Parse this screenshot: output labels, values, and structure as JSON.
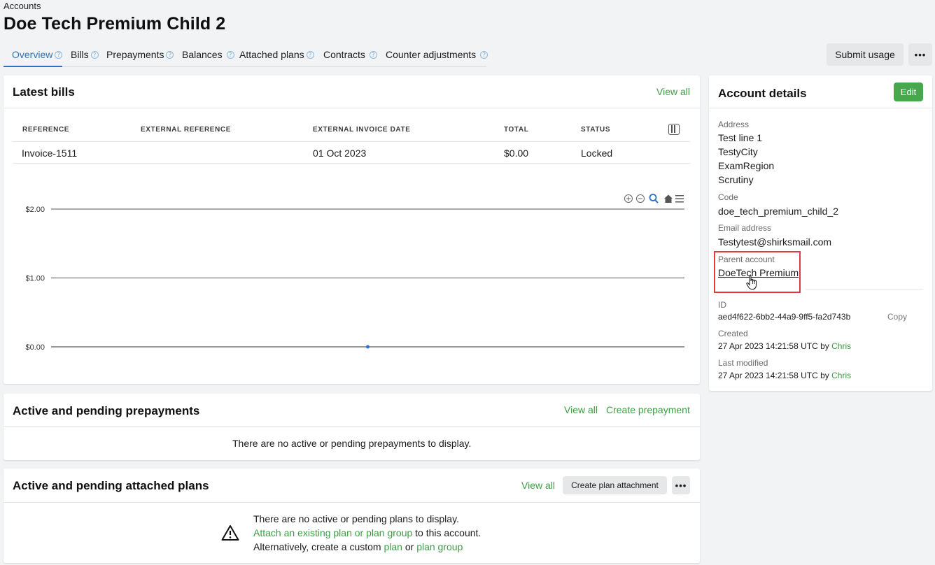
{
  "breadcrumb": "Accounts",
  "title": "Doe Tech Premium Child 2",
  "tabs": [
    {
      "label": "Overview"
    },
    {
      "label": "Bills"
    },
    {
      "label": "Prepayments"
    },
    {
      "label": "Balances"
    },
    {
      "label": "Attached plans"
    },
    {
      "label": "Contracts"
    },
    {
      "label": "Counter adjustments"
    }
  ],
  "help_glyph": "?",
  "header_actions": {
    "submit_usage": "Submit usage",
    "more": "•••"
  },
  "latest_bills": {
    "title": "Latest bills",
    "view_all": "View all",
    "columns": [
      "REFERENCE",
      "EXTERNAL REFERENCE",
      "EXTERNAL INVOICE DATE",
      "TOTAL",
      "STATUS"
    ],
    "rows": [
      {
        "reference": "Invoice-1511",
        "external_reference": "",
        "external_invoice_date": "01 Oct 2023",
        "total": "$0.00",
        "status": "Locked"
      }
    ]
  },
  "chart_data": {
    "type": "line",
    "title": "",
    "xlabel": "",
    "ylabel": "",
    "y_ticks": [
      "$2.00",
      "$1.00",
      "$0.00"
    ],
    "ylim": [
      0,
      2
    ],
    "grid": true,
    "series": [
      {
        "values": [
          0
        ]
      }
    ],
    "point_color": "#2f6fd6",
    "toolbar_icons": [
      "zoom-in-icon",
      "zoom-out-icon",
      "magnifier-icon",
      "home-icon",
      "menu-icon"
    ]
  },
  "prepayments": {
    "title": "Active and pending prepayments",
    "view_all": "View all",
    "create": "Create prepayment",
    "empty": "There are no active or pending prepayments to display."
  },
  "attached_plans": {
    "title": "Active and pending attached plans",
    "view_all": "View all",
    "create": "Create plan attachment",
    "more": "•••",
    "empty_line1": "There are no active or pending plans to display.",
    "attach_link": "Attach an existing plan or plan group",
    "attach_suffix": " to this account.",
    "alt_prefix": "Alternatively, create a custom ",
    "plan_link": "plan",
    "or": " or ",
    "plan_group_link": "plan group"
  },
  "account_details": {
    "title": "Account details",
    "edit": "Edit",
    "address_label": "Address",
    "address_lines": [
      "Test line 1",
      "TestyCity",
      "ExamRegion",
      "Scrutiny"
    ],
    "code_label": "Code",
    "code": "doe_tech_premium_child_2",
    "email_label": "Email address",
    "email": "Testytest@shirksmail.com",
    "parent_label": "Parent account",
    "parent": "DoeTech Premium",
    "id_label": "ID",
    "id": "aed4f622-6bb2-44a9-9ff5-fa2d743b",
    "copy": "Copy",
    "created_label": "Created",
    "created": "27 Apr 2023 14:21:58 UTC by ",
    "created_by": "Chris",
    "modified_label": "Last modified",
    "modified": "27 Apr 2023 14:21:58 UTC by ",
    "modified_by": "Chris"
  },
  "colors": {
    "accent": "#2f72b8",
    "green": "#3e9c45",
    "highlight": "#e03a3a"
  }
}
